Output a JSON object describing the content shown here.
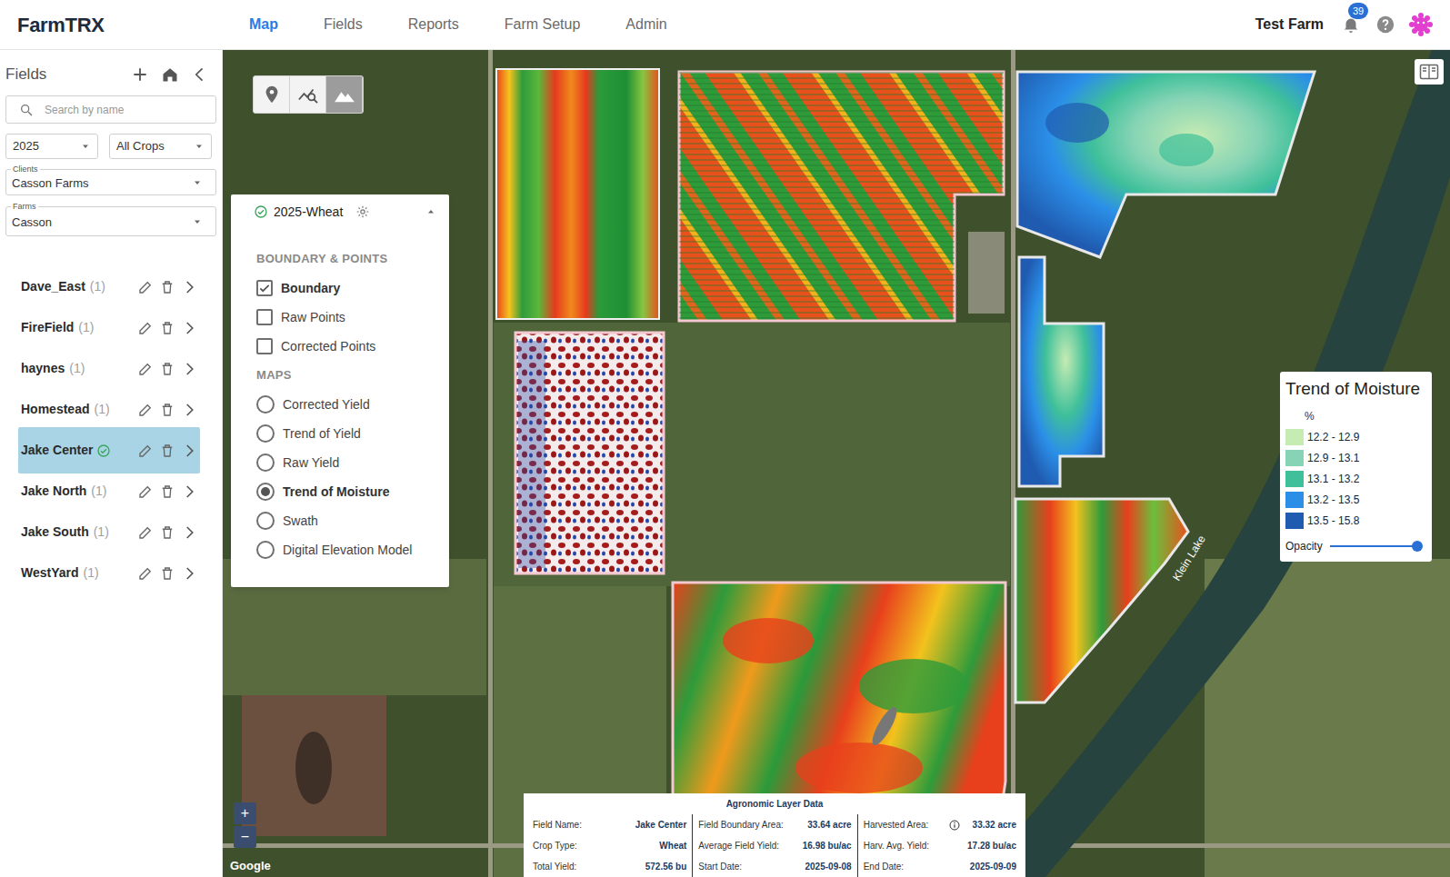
{
  "header": {
    "logo": "FarmTRX",
    "nav": [
      {
        "label": "Map",
        "selected": true
      },
      {
        "label": "Fields",
        "selected": false
      },
      {
        "label": "Reports",
        "selected": false
      },
      {
        "label": "Farm Setup",
        "selected": false
      },
      {
        "label": "Admin",
        "selected": false
      }
    ],
    "farm": "Test Farm",
    "notifications": "39"
  },
  "sidebar": {
    "title": "Fields",
    "search_placeholder": "Search by name",
    "year": "2025",
    "crop": "All Crops",
    "clients_label": "Clients",
    "client": "Casson Farms",
    "farms_label": "Farms",
    "farm": "Casson",
    "fields": [
      {
        "name": "Dave_East",
        "count": "(1)",
        "selected": false
      },
      {
        "name": "FireField",
        "count": "(1)",
        "selected": false
      },
      {
        "name": "haynes",
        "count": "(1)",
        "selected": false
      },
      {
        "name": "Homestead",
        "count": "(1)",
        "selected": false
      },
      {
        "name": "Jake Center",
        "selected": true
      },
      {
        "name": "Jake North",
        "count": "(1)",
        "selected": false
      },
      {
        "name": "Jake South",
        "count": "(1)",
        "selected": false
      },
      {
        "name": "WestYard",
        "count": "(1)",
        "selected": false
      }
    ]
  },
  "toolbar": [
    {
      "selected": false
    },
    {
      "selected": false
    },
    {
      "selected": true
    }
  ],
  "layer_panel": {
    "title": "2025-Wheat",
    "active": true,
    "expanded": true,
    "sections": [
      {
        "title": "BOUNDARY & POINTS",
        "kind": "checkbox",
        "items": [
          {
            "label": "Boundary",
            "checked": true
          },
          {
            "label": "Raw Points",
            "checked": false
          },
          {
            "label": "Corrected Points",
            "checked": false
          }
        ]
      },
      {
        "title": "MAPS",
        "kind": "radio",
        "items": [
          {
            "label": "Corrected Yield",
            "selected": false
          },
          {
            "label": "Trend of Yield",
            "selected": false
          },
          {
            "label": "Raw Yield",
            "selected": false
          },
          {
            "label": "Trend of Moisture",
            "selected": true
          },
          {
            "label": "Swath",
            "selected": false
          },
          {
            "label": "Digital Elevation Model",
            "selected": false
          }
        ]
      }
    ]
  },
  "legend": {
    "title": "Trend of Moisture",
    "unit": "%",
    "items": [
      {
        "label": "12.2 - 12.9",
        "color": "#c6ebb3"
      },
      {
        "label": "12.9 - 13.1",
        "color": "#86d4b5"
      },
      {
        "label": "13.1 - 13.2",
        "color": "#3fc09a"
      },
      {
        "label": "13.2 - 13.5",
        "color": "#2b8fe8"
      },
      {
        "label": "13.5 - 15.8",
        "color": "#1f5bb0"
      }
    ],
    "opacity_label": "Opacity",
    "opacity_level": 1
  },
  "zoom": {
    "in": "+",
    "out": "−"
  },
  "map_labels": {
    "lake": "Klein Lake",
    "attribution": "Google"
  },
  "info": {
    "title": "Agronomic Layer Data",
    "columns": [
      [
        {
          "label": "Field Name:",
          "value": "Jake Center",
          "kind": "plain"
        },
        {
          "label": "Crop Type:",
          "value": "Wheat",
          "kind": "plain"
        },
        {
          "label": "Total Yield:",
          "value": "572.56 bu",
          "kind": "plain"
        }
      ],
      [
        {
          "label": "Field Boundary Area:",
          "value": "33.64 acre",
          "kind": "plain"
        },
        {
          "label": "Average Field Yield:",
          "value": "16.98 bu/ac",
          "kind": "plain"
        },
        {
          "label": "Start Date:",
          "value": "2025-09-08",
          "kind": "plain"
        }
      ],
      [
        {
          "label": "Harvested Area:",
          "value": "33.32 acre",
          "kind": "info"
        },
        {
          "label": "Harv. Avg. Yield:",
          "value": "17.28 bu/ac",
          "kind": "plain"
        },
        {
          "label": "End Date:",
          "value": "2025-09-09",
          "kind": "plain"
        }
      ]
    ]
  }
}
